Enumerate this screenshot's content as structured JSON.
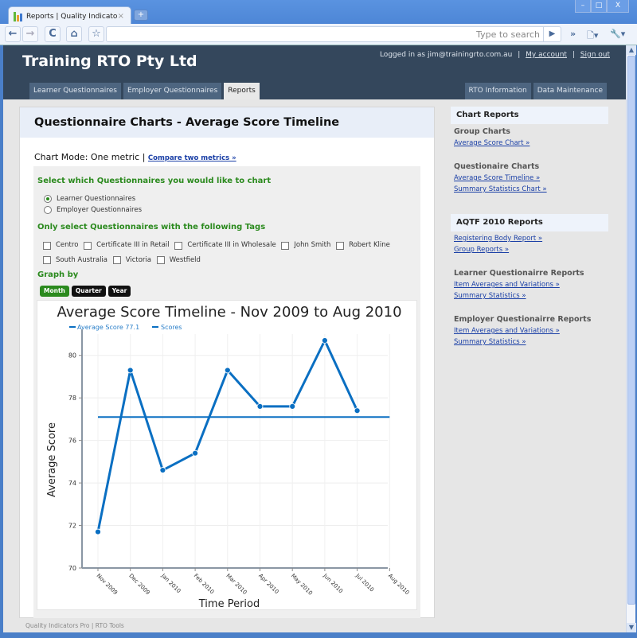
{
  "browser": {
    "tab_title": "Reports | Quality Indicator...",
    "tab_close": "×",
    "new_tab": "+",
    "search_placeholder": "Type to search",
    "back": "←",
    "forward": "→",
    "reload": "C",
    "home": "⌂",
    "star": "☆",
    "go": "▶",
    "more": "»",
    "page": "🗋▾",
    "wrench": "🔧▾",
    "win_min": "–",
    "win_max": "□",
    "win_close": "X"
  },
  "header": {
    "site_title": "Training RTO Pty Ltd",
    "logged_in_text": "Logged in as jim@trainingrto.com.au",
    "my_account": "My account",
    "sign_out": "Sign out",
    "separator": "|",
    "nav_left": [
      "Learner Questionnaires",
      "Employer Questionnaires",
      "Reports"
    ],
    "nav_right": [
      "RTO Information",
      "Data Maintenance"
    ],
    "active_tab": "Reports"
  },
  "main": {
    "page_title": "Questionnaire Charts - Average Score Timeline",
    "chart_mode_label": "Chart Mode: One metric |",
    "compare_link": "Compare two metrics »",
    "select_heading": "Select which Questionnaires you would like to chart",
    "radio_options": [
      {
        "label": "Learner Questionnaires",
        "checked": true
      },
      {
        "label": "Employer Questionnaires",
        "checked": false
      }
    ],
    "tags_heading": "Only select Questionnaires with the following Tags",
    "tags": [
      "Centro",
      "Certificate III in Retail",
      "Certificate III in Wholesale",
      "John Smith",
      "Robert Kline",
      "South Australia",
      "Victoria",
      "Westfield"
    ],
    "graph_by_heading": "Graph by",
    "graph_by_options": [
      "Month",
      "Quarter",
      "Year"
    ],
    "graph_by_selected": "Month"
  },
  "footer": "Quality Indicators Pro | RTO Tools",
  "sidebar": {
    "sections": [
      {
        "heading": "Chart Reports",
        "groups": [
          {
            "title": "Group Charts",
            "links": [
              "Average Score Chart »"
            ]
          },
          {
            "title": "Questionaire Charts",
            "links": [
              "Average Score Timeline »",
              "Summary Statistics Chart »"
            ]
          }
        ]
      },
      {
        "heading": "AQTF 2010 Reports",
        "groups": [
          {
            "title": "",
            "links": [
              "Registering Body Report »",
              "Group Reports »"
            ]
          },
          {
            "title": "Learner Questionairre Reports",
            "links": [
              "Item Averages and Variations »",
              "Summary Statistics »"
            ]
          },
          {
            "title": "Employer Questionairre Reports",
            "links": [
              "Item Averages and Variations »",
              "Summary Statistics »"
            ]
          }
        ]
      }
    ]
  },
  "colors": {
    "series": "#0a6fc2",
    "header_bg": "#34475c",
    "accent_green": "#2b8a1e",
    "link": "#1a3fa6"
  },
  "chart_data": {
    "type": "line",
    "title": "Average Score Timeline - Nov 2009 to Aug 2010",
    "xlabel": "Time Period",
    "ylabel": "Average Score",
    "categories": [
      "Nov 2009",
      "Dec 2009",
      "Jan 2010",
      "Feb 2010",
      "Mar 2010",
      "Apr 2010",
      "May 2010",
      "Jun 2010",
      "Jul 2010",
      "Aug 2010"
    ],
    "yticks": [
      70,
      72,
      74,
      76,
      78,
      80
    ],
    "ylim": [
      70,
      81
    ],
    "grid": true,
    "legend": [
      "Average Score 77.1",
      "Scores"
    ],
    "legend_position": "top-left",
    "series": [
      {
        "name": "Average Score 77.1",
        "values": [
          77.1,
          77.1,
          77.1,
          77.1,
          77.1,
          77.1,
          77.1,
          77.1,
          77.1,
          77.1
        ]
      },
      {
        "name": "Scores",
        "values": [
          71.7,
          79.3,
          74.6,
          75.4,
          79.3,
          77.6,
          77.6,
          80.7,
          77.4,
          null
        ]
      }
    ]
  }
}
